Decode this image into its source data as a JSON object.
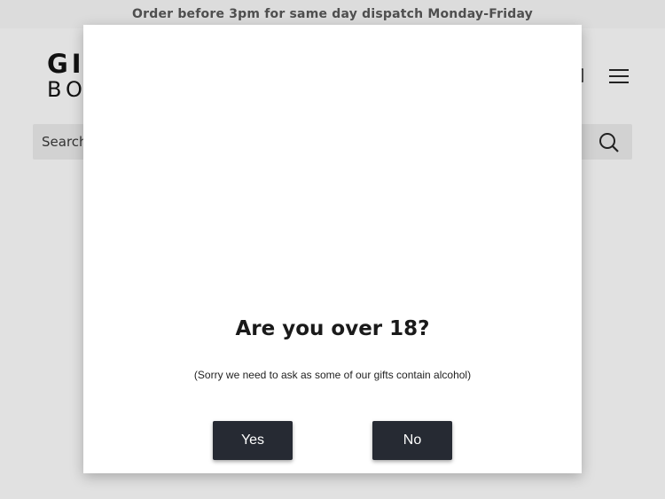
{
  "announcement": {
    "text": "Order before 3pm for same day dispatch Monday-Friday"
  },
  "header": {
    "logo_line1": "GI",
    "logo_line2": "BO"
  },
  "search": {
    "placeholder": "Search"
  },
  "modal": {
    "title": "Are you over 18?",
    "subtitle": "(Sorry we need to ask as some of our gifts contain alcohol)",
    "yes_label": "Yes",
    "no_label": "No"
  },
  "colors": {
    "background": "#e1e1e1",
    "modal_bg": "#ffffff",
    "button_bg": "#262a33",
    "button_text": "#ffffff"
  }
}
